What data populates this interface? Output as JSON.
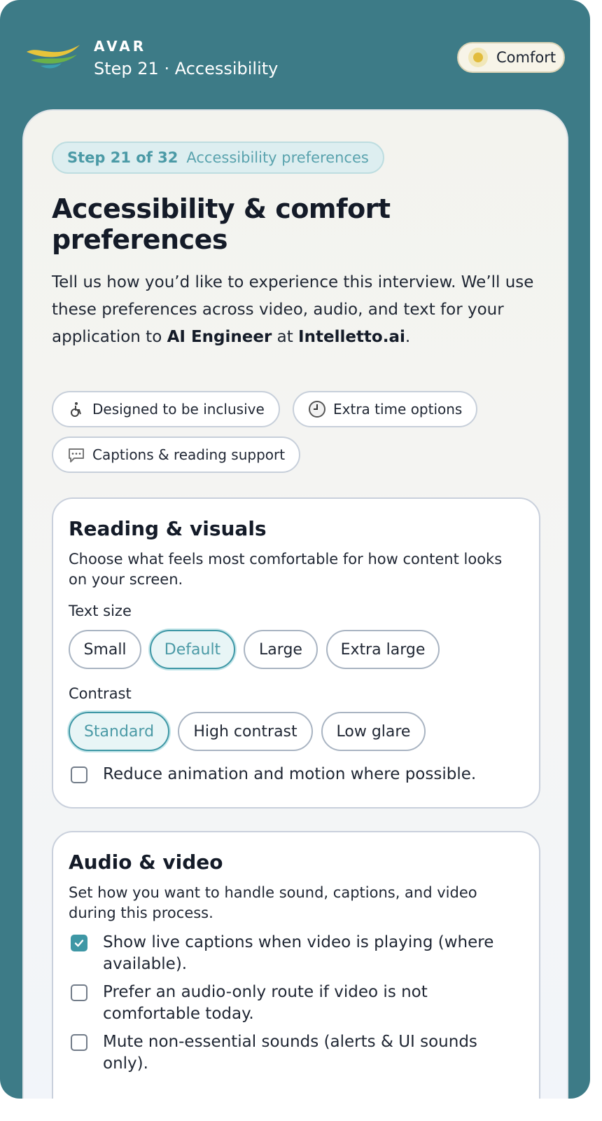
{
  "header": {
    "brand": "AVAR",
    "subtitle": "Step 21 · Accessibility",
    "comfort_label": "Comfort"
  },
  "colors": {
    "frame": "#3d7b87",
    "accent": "#3e97a5",
    "comfort_dot": "#e2bc3c"
  },
  "step_pill": {
    "number": "Step 21 of 32",
    "label": "Accessibility preferences"
  },
  "page_title": "Accessibility & comfort preferences",
  "intro": {
    "text": "Tell us how you’d like to experience this interview. We’ll use these preferences across video, audio, and text for your application to ",
    "role": "AI Engineer",
    "joiner": " at ",
    "company": "Intelletto.ai",
    "end": "."
  },
  "tags": [
    {
      "icon": "wheelchair-icon",
      "label": "Designed to be inclusive"
    },
    {
      "icon": "clock-icon",
      "label": "Extra time options"
    },
    {
      "icon": "speech-bubble-icon",
      "label": "Captions & reading support"
    }
  ],
  "reading": {
    "title": "Reading & visuals",
    "description": "Choose what feels most comfortable for how content looks on your screen.",
    "text_size_label": "Text size",
    "text_sizes": [
      "Small",
      "Default",
      "Large",
      "Extra large"
    ],
    "text_size_selected": "Default",
    "contrast_label": "Contrast",
    "contrasts": [
      "Standard",
      "High contrast",
      "Low glare"
    ],
    "contrast_selected": "Standard",
    "reduce_motion": {
      "label": "Reduce animation and motion where possible.",
      "checked": false
    }
  },
  "audio": {
    "title": "Audio & video",
    "description": "Set how you want to handle sound, captions, and video during this process.",
    "options": [
      {
        "label": "Show live captions when video is playing (where available).",
        "checked": true
      },
      {
        "label": "Prefer an audio-only route if video is not comfortable today.",
        "checked": false
      },
      {
        "label": "Mute non-essential sounds (alerts & UI sounds only).",
        "checked": false
      }
    ]
  }
}
